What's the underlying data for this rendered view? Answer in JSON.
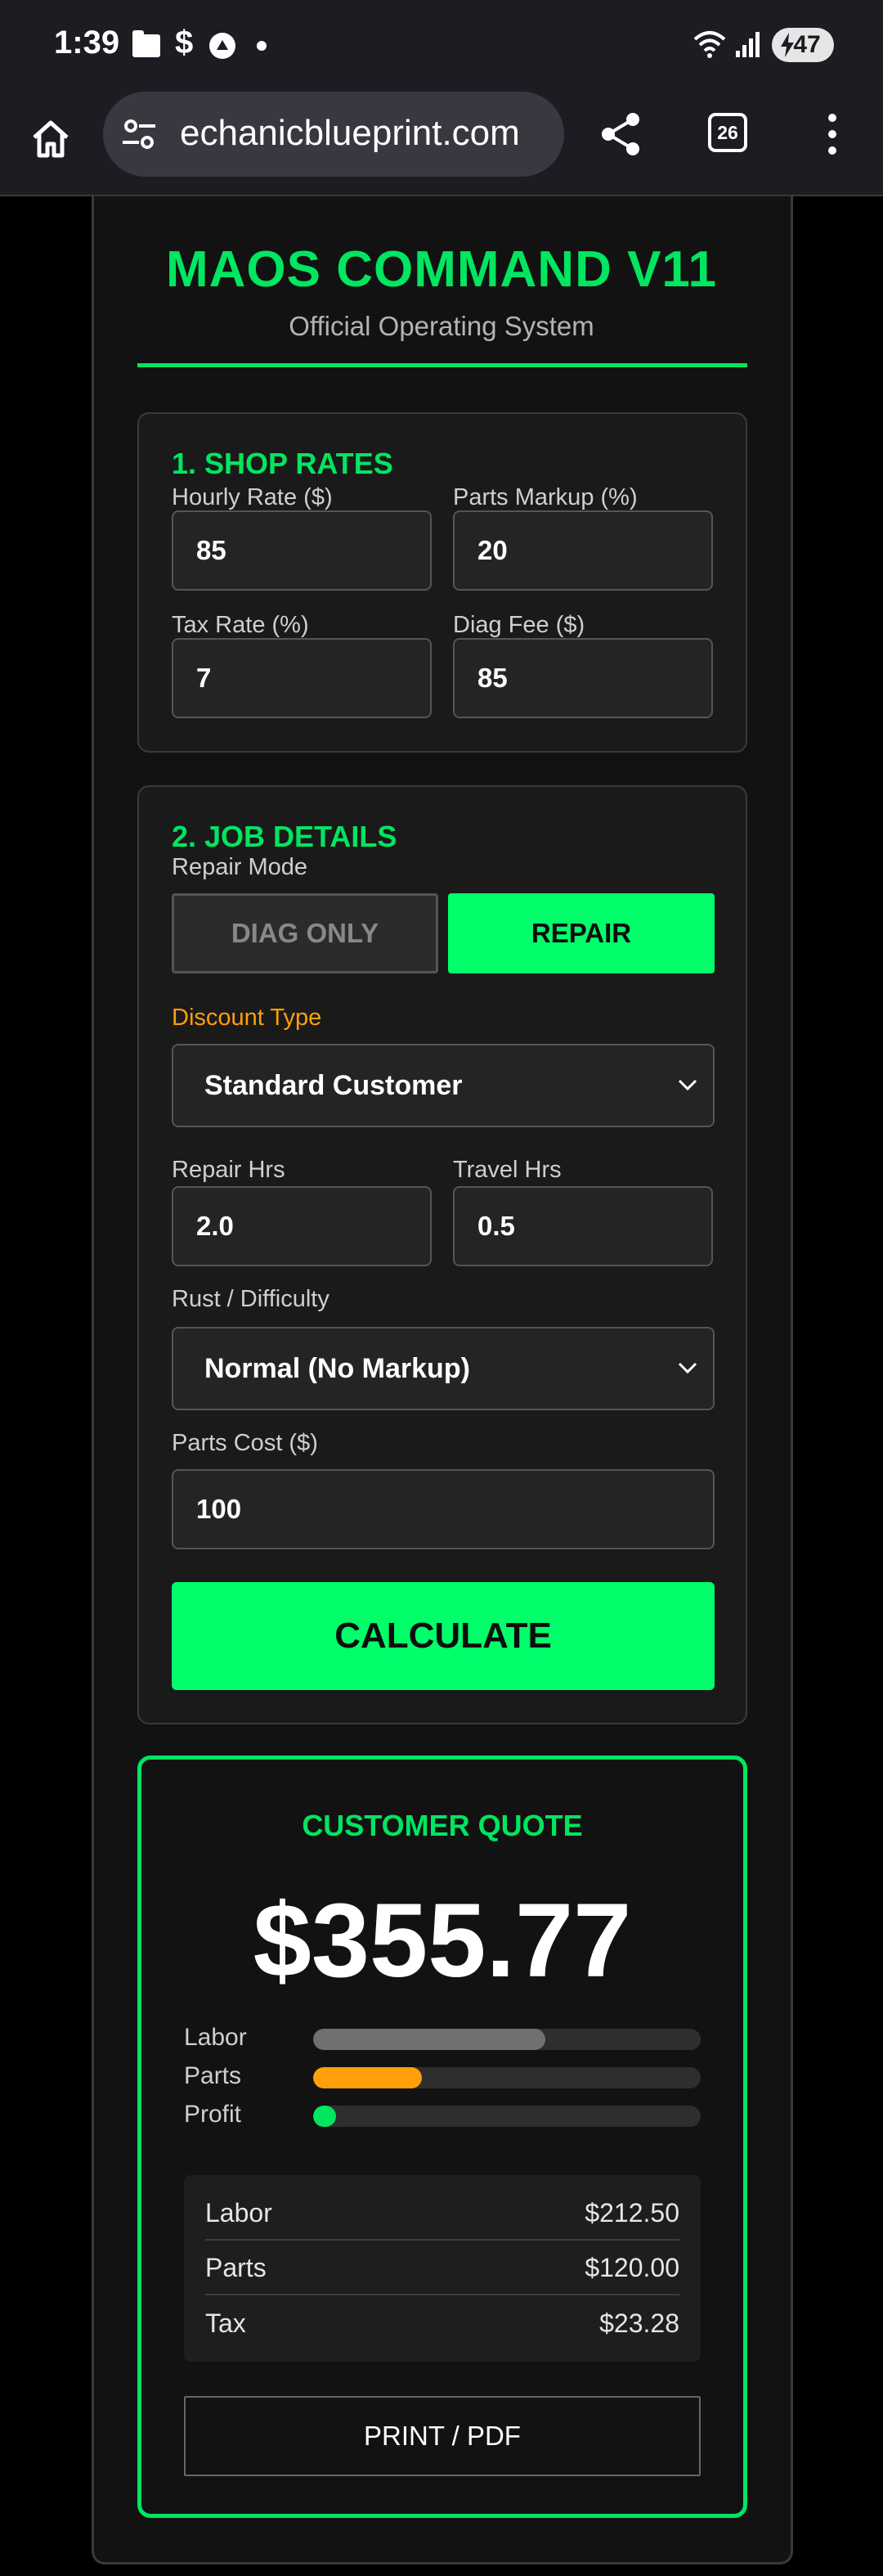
{
  "status_bar": {
    "time": "1:39",
    "dollar_glyph": "$",
    "battery_level": "47",
    "icons": [
      "folder-icon",
      "dollar-icon",
      "assistant-icon",
      "notification-dot-icon",
      "wifi-icon",
      "signal-icon",
      "battery-charging-icon"
    ]
  },
  "browser": {
    "url": "echanicblueprint.com",
    "tab_count": "26",
    "icons": [
      "home-icon",
      "site-settings-icon",
      "share-icon",
      "tabs-icon",
      "overflow-menu-icon"
    ]
  },
  "header": {
    "title": "MAOS COMMAND V11",
    "subtitle": "Official Operating System"
  },
  "shop_rates": {
    "title": "1. SHOP RATES",
    "hourly_rate": {
      "label": "Hourly Rate ($)",
      "value": "85"
    },
    "parts_markup": {
      "label": "Parts Markup (%)",
      "value": "20"
    },
    "tax_rate": {
      "label": "Tax Rate (%)",
      "value": "7"
    },
    "diag_fee": {
      "label": "Diag Fee ($)",
      "value": "85"
    }
  },
  "job_details": {
    "title": "2. JOB DETAILS",
    "repair_mode_label": "Repair Mode",
    "mode_diag_label": "DIAG ONLY",
    "mode_repair_label": "REPAIR",
    "selected_mode": "REPAIR",
    "discount_label": "Discount Type",
    "discount_value": "Standard Customer",
    "repair_hrs": {
      "label": "Repair Hrs",
      "value": "2.0"
    },
    "travel_hrs": {
      "label": "Travel Hrs",
      "value": "0.5"
    },
    "difficulty_label": "Rust / Difficulty",
    "difficulty_value": "Normal (No Markup)",
    "parts_cost": {
      "label": "Parts Cost ($)",
      "value": "100"
    },
    "calculate_label": "CALCULATE"
  },
  "quote": {
    "title": "CUSTOMER QUOTE",
    "total": "$355.77",
    "bars": [
      {
        "label": "Labor",
        "fraction": 0.6,
        "color": "#707070"
      },
      {
        "label": "Parts",
        "fraction": 0.28,
        "color": "#ff9f0a"
      },
      {
        "label": "Profit",
        "fraction": 0.06,
        "color": "#00e660"
      }
    ],
    "breakdown": [
      {
        "label": "Labor",
        "amount": "$212.50"
      },
      {
        "label": "Parts",
        "amount": "$120.00"
      },
      {
        "label": "Tax",
        "amount": "$23.28"
      }
    ],
    "print_label": "PRINT / PDF"
  },
  "colors": {
    "accent_green": "#00e660",
    "button_green": "#00ff6a",
    "discount_label_orange": "#ff9f0a",
    "panel_bg": "#1a1a1a"
  }
}
